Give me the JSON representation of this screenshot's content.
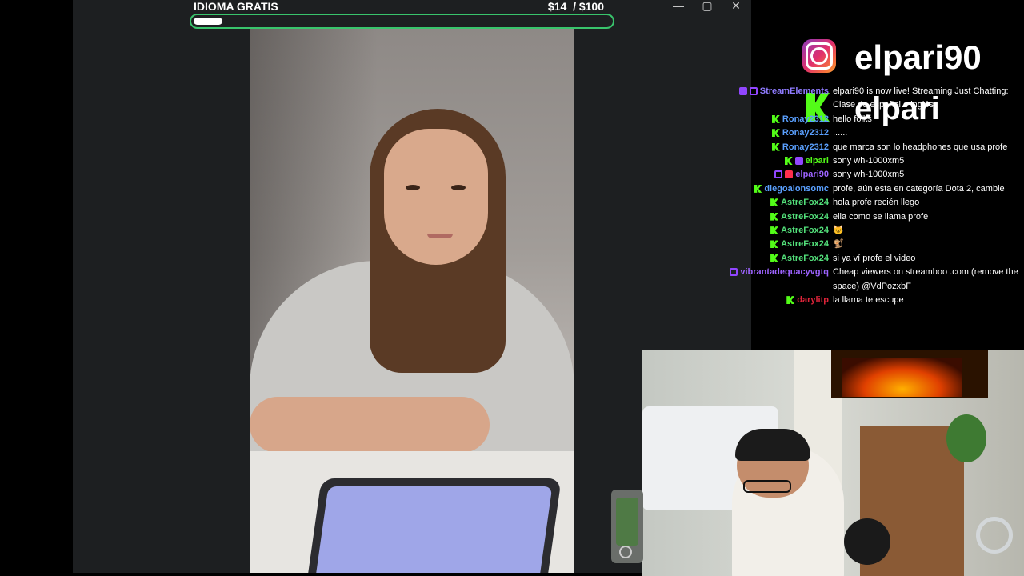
{
  "goal": {
    "title": "IDIOMA GRATIS",
    "amount": "$14",
    "target": "/ $100",
    "progress_fraction": 0.14
  },
  "window": {
    "minimize": "—",
    "maximize": "▢",
    "close": "✕"
  },
  "overlay": {
    "instagram_handle": "elpari90",
    "kick_handle": "elpari"
  },
  "chat": [
    {
      "user": "StreamElements",
      "color": "#8f7bff",
      "badges": [
        "mod",
        "twitch"
      ],
      "text": "elpari90 is now live! Streaming Just Chatting: Clase de español e inglés"
    },
    {
      "user": "Ronay2312",
      "color": "#5aa0ff",
      "badges": [
        "kick"
      ],
      "text": "hello folks"
    },
    {
      "user": "Ronay2312",
      "color": "#5aa0ff",
      "badges": [
        "kick"
      ],
      "text": "......"
    },
    {
      "user": "Ronay2312",
      "color": "#5aa0ff",
      "badges": [
        "kick"
      ],
      "text": "que marca son lo headphones que usa profe"
    },
    {
      "user": "elpari",
      "color": "#53fc18",
      "badges": [
        "kick",
        "mod"
      ],
      "text": "sony wh-1000xm5"
    },
    {
      "user": "elpari90",
      "color": "#9d63ff",
      "badges": [
        "twitch",
        "yt"
      ],
      "text": "sony wh-1000xm5"
    },
    {
      "user": "diegoalonsomc",
      "color": "#5aa0ff",
      "badges": [
        "kick"
      ],
      "text": "profe, aún esta en categoría Dota 2, cambie"
    },
    {
      "user": "AstreFox24",
      "color": "#53e07a",
      "badges": [
        "kick"
      ],
      "text": "hola profe recién llego"
    },
    {
      "user": "AstreFox24",
      "color": "#53e07a",
      "badges": [
        "kick"
      ],
      "text": "ella como se llama profe"
    },
    {
      "user": "AstreFox24",
      "color": "#53e07a",
      "badges": [
        "kick"
      ],
      "text": "🐱"
    },
    {
      "user": "AstreFox24",
      "color": "#53e07a",
      "badges": [
        "kick"
      ],
      "text": "🐒"
    },
    {
      "user": "AstreFox24",
      "color": "#53e07a",
      "badges": [
        "kick"
      ],
      "text": "si ya ví profe el video"
    },
    {
      "user": "vibrantadequacyvgtq",
      "color": "#9d63ff",
      "badges": [
        "twitch"
      ],
      "text": "Cheap viewers on streamboo .com (remove the space) @VdPozxbF"
    },
    {
      "user": "darylitp",
      "color": "#e0243a",
      "badges": [
        "kick"
      ],
      "text": "la llama te escupe"
    }
  ]
}
